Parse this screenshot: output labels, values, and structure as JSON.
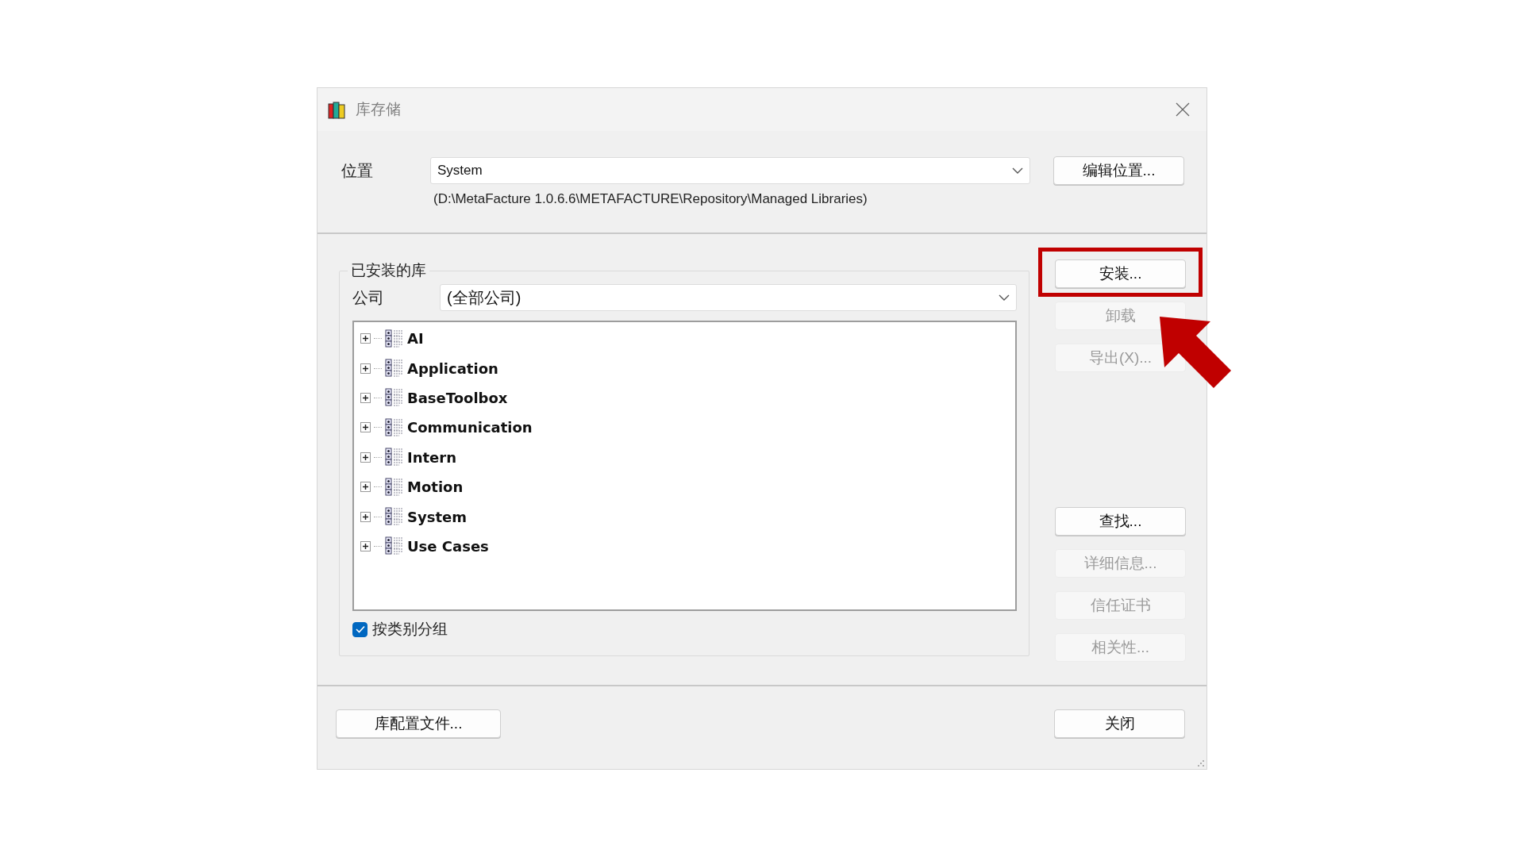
{
  "window": {
    "title": "库存储"
  },
  "location": {
    "label": "位置",
    "value": "System",
    "path": "(D:\\MetaFacture 1.0.6.6\\METAFACTURE\\Repository\\Managed Libraries)",
    "button": "编辑位置..."
  },
  "installed": {
    "title": "已安装的库",
    "company_label": "公司",
    "company_value": "(全部公司)",
    "tree": [
      {
        "label": "AI",
        "expanded": false
      },
      {
        "label": "Application",
        "expanded": false
      },
      {
        "label": "BaseToolbox",
        "expanded": false
      },
      {
        "label": "Communication",
        "expanded": false
      },
      {
        "label": "Intern",
        "expanded": false
      },
      {
        "label": "Motion",
        "expanded": false
      },
      {
        "label": "System",
        "expanded": false
      },
      {
        "label": "Use Cases",
        "expanded": false
      }
    ],
    "group_by_category": {
      "label": "按类别分组",
      "checked": true
    }
  },
  "actions_top": [
    {
      "label": "安装...",
      "disabled": false,
      "highlighted": true
    },
    {
      "label": "卸载",
      "disabled": true,
      "highlighted": false
    },
    {
      "label": "导出(X)...",
      "disabled": true,
      "highlighted": false
    }
  ],
  "actions_bottom": [
    {
      "label": "查找...",
      "disabled": false,
      "highlighted": false
    },
    {
      "label": "详细信息...",
      "disabled": true,
      "highlighted": false
    },
    {
      "label": "信任证书",
      "disabled": true,
      "highlighted": false
    },
    {
      "label": "相关性...",
      "disabled": true,
      "highlighted": false
    }
  ],
  "footer": {
    "profiles_button": "库配置文件...",
    "close_button": "关闭"
  }
}
